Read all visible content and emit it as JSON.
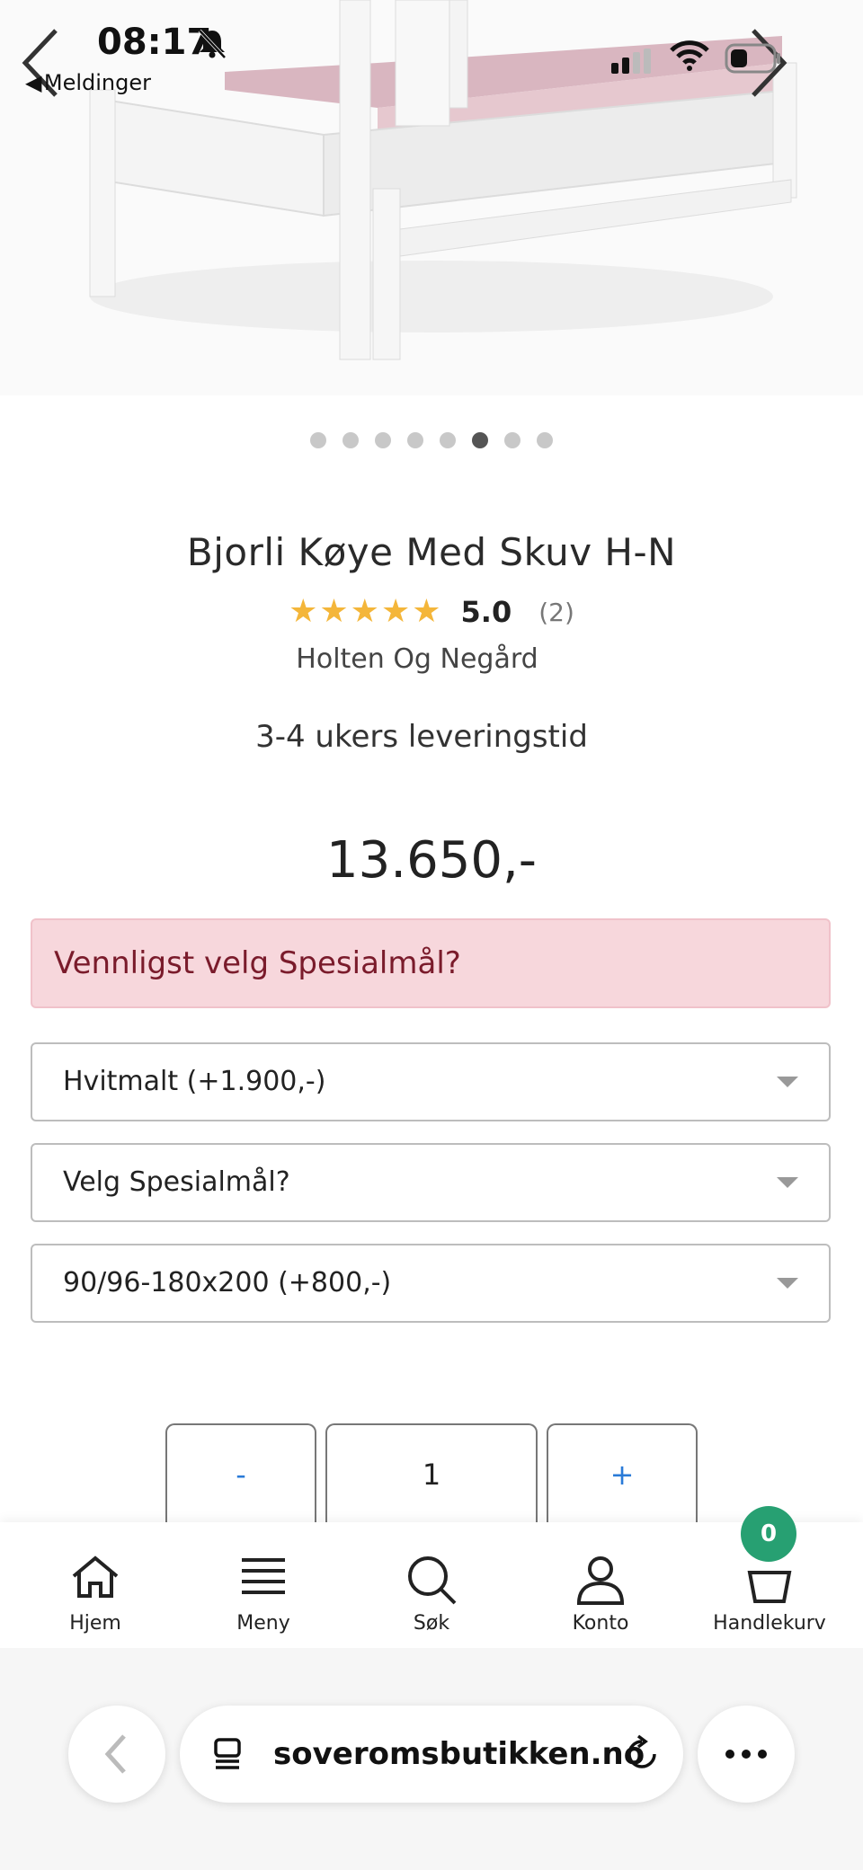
{
  "status_bar": {
    "time": "08:17",
    "back_app": "Meldinger"
  },
  "carousel": {
    "count": 8,
    "active_index": 5
  },
  "product": {
    "title": "Bjorli Køye Med Skuv H-N",
    "rating_value": "5.0",
    "rating_count": "(2)",
    "stars": 5,
    "brand": "Holten Og Negård",
    "delivery": "3-4 ukers leveringstid",
    "price": "13.650,-"
  },
  "alert": {
    "text": "Vennligst velg Spesialmål?"
  },
  "selects": [
    {
      "value": "Hvitmalt (+1.900,-)"
    },
    {
      "value": "Velg Spesialmål?"
    },
    {
      "value": "90/96-180x200 (+800,-)"
    }
  ],
  "quantity": {
    "minus": "-",
    "value": "1",
    "plus": "+"
  },
  "bottom_nav": {
    "items": [
      {
        "label": "Hjem",
        "icon": "home-icon"
      },
      {
        "label": "Meny",
        "icon": "menu-icon"
      },
      {
        "label": "Søk",
        "icon": "search-icon"
      },
      {
        "label": "Konto",
        "icon": "account-icon"
      },
      {
        "label": "Handlekurv",
        "icon": "basket-icon"
      }
    ],
    "cart_count": "0"
  },
  "browser": {
    "url": "soveromsbutikken.no"
  },
  "colors": {
    "accent": "#2a7bd8",
    "badge": "#27a072",
    "alert_bg": "#f7d7dc",
    "star": "#f4b63a"
  }
}
